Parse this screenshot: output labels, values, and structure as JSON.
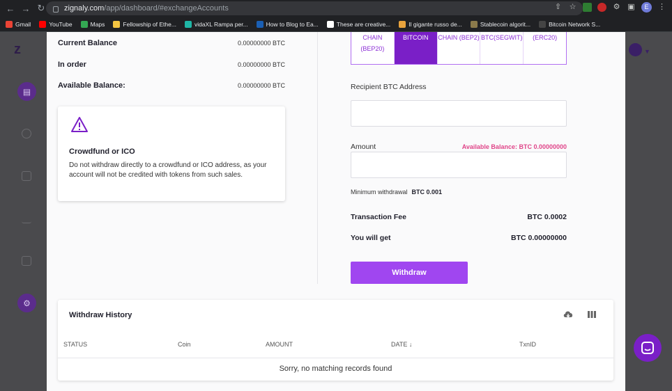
{
  "browser": {
    "url_host": "zignaly.com",
    "url_path": "/app/dashboard/#exchangeAccounts",
    "profile_initial": "E",
    "bookmarks": [
      {
        "label": "Gmail",
        "color": "#ea4335"
      },
      {
        "label": "YouTube",
        "color": "#ff0000"
      },
      {
        "label": "Maps",
        "color": "#34a853"
      },
      {
        "label": "Fellowship of Ethe...",
        "color": "#f4c542"
      },
      {
        "label": "vidaXL Rampa per...",
        "color": "#1fb6a6"
      },
      {
        "label": "How to Blog to Ea...",
        "color": "#1a5fb4"
      },
      {
        "label": "These are creative...",
        "color": "#ffffff"
      },
      {
        "label": "Il gigante russo de...",
        "color": "#e8a33d"
      },
      {
        "label": "Stablecoin algorit...",
        "color": "#8b7a4b"
      },
      {
        "label": "Bitcoin Network S...",
        "color": "#444444"
      }
    ]
  },
  "balances": {
    "current_label": "Current Balance",
    "current_value": "0.00000000 BTC",
    "in_order_label": "In order",
    "in_order_value": "0.00000000 BTC",
    "available_label": "Available Balance:",
    "available_value": "0.00000000 BTC"
  },
  "warning": {
    "title": "Crowdfund or ICO",
    "text": "Do not withdraw directly to a crowdfund or ICO address, as your account will not be credited with tokens from such sales."
  },
  "networks": [
    {
      "label": "CHAIN (BEP20)",
      "active": false
    },
    {
      "label": "BITCOIN",
      "active": true
    },
    {
      "label": "CHAIN (BEP2)",
      "active": false
    },
    {
      "label": "BTC(SEGWIT)",
      "active": false
    },
    {
      "label": "(ERC20)",
      "active": false
    }
  ],
  "form": {
    "address_label": "Recipient BTC Address",
    "amount_label": "Amount",
    "available_balance": "Available Balance:  BTC 0.00000000",
    "min_withdrawal_label": "Minimum withdrawal",
    "min_withdrawal_value": "BTC 0.001",
    "fee_label": "Transaction Fee",
    "fee_value": "BTC 0.0002",
    "get_label": "You will get",
    "get_value": "BTC 0.00000000",
    "withdraw_label": "Withdraw"
  },
  "history": {
    "title": "Withdraw History",
    "columns": [
      "STATUS",
      "Coin",
      "AMOUNT",
      "DATE",
      "TxnID"
    ],
    "empty_text": "Sorry, no matching records found"
  },
  "colors": {
    "accent": "#a046f0",
    "tab_active": "#7a1fc7",
    "available_pink": "#e04589"
  }
}
